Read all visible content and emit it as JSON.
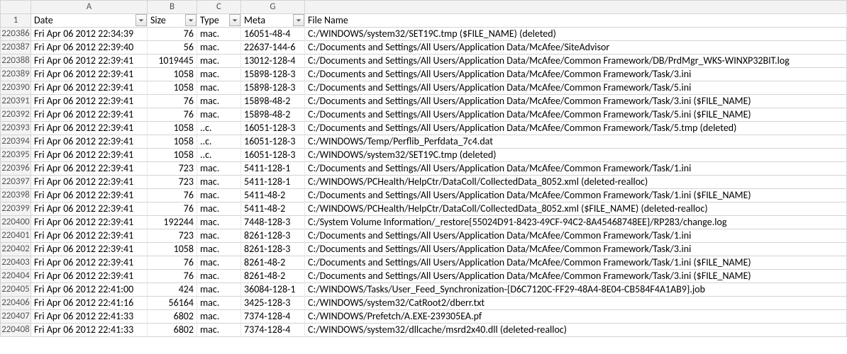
{
  "columns": {
    "letters": [
      "",
      "A",
      "B",
      "C",
      "G",
      ""
    ],
    "headers": [
      "Date",
      "Size",
      "Type",
      "Meta",
      "File Name"
    ],
    "filters": [
      true,
      true,
      true,
      true,
      false
    ],
    "header_row_number": "1"
  },
  "rows": [
    {
      "n": "220386",
      "date": "Fri Apr 06 2012 22:34:39",
      "size": "76",
      "type": "mac.",
      "meta": "16051-48-4",
      "file": "C:/WINDOWS/system32/SET19C.tmp ($FILE_NAME) (deleted)"
    },
    {
      "n": "220387",
      "date": "Fri Apr 06 2012 22:39:40",
      "size": "56",
      "type": "mac.",
      "meta": "22637-144-6",
      "file": "C:/Documents and Settings/All Users/Application Data/McAfee/SiteAdvisor"
    },
    {
      "n": "220388",
      "date": "Fri Apr 06 2012 22:39:41",
      "size": "1019445",
      "type": "mac.",
      "meta": "13012-128-4",
      "file": "C:/Documents and Settings/All Users/Application Data/McAfee/Common Framework/DB/PrdMgr_WKS-WINXP32BIT.log"
    },
    {
      "n": "220389",
      "date": "Fri Apr 06 2012 22:39:41",
      "size": "1058",
      "type": "mac.",
      "meta": "15898-128-3",
      "file": "C:/Documents and Settings/All Users/Application Data/McAfee/Common Framework/Task/3.ini"
    },
    {
      "n": "220390",
      "date": "Fri Apr 06 2012 22:39:41",
      "size": "1058",
      "type": "mac.",
      "meta": "15898-128-3",
      "file": "C:/Documents and Settings/All Users/Application Data/McAfee/Common Framework/Task/5.ini"
    },
    {
      "n": "220391",
      "date": "Fri Apr 06 2012 22:39:41",
      "size": "76",
      "type": "mac.",
      "meta": "15898-48-2",
      "file": "C:/Documents and Settings/All Users/Application Data/McAfee/Common Framework/Task/3.ini ($FILE_NAME)"
    },
    {
      "n": "220392",
      "date": "Fri Apr 06 2012 22:39:41",
      "size": "76",
      "type": "mac.",
      "meta": "15898-48-2",
      "file": "C:/Documents and Settings/All Users/Application Data/McAfee/Common Framework/Task/5.ini ($FILE_NAME)"
    },
    {
      "n": "220393",
      "date": "Fri Apr 06 2012 22:39:41",
      "size": "1058",
      "type": "..c.",
      "meta": "16051-128-3",
      "file": "C:/Documents and Settings/All Users/Application Data/McAfee/Common Framework/Task/5.tmp (deleted)"
    },
    {
      "n": "220394",
      "date": "Fri Apr 06 2012 22:39:41",
      "size": "1058",
      "type": "..c.",
      "meta": "16051-128-3",
      "file": "C:/WINDOWS/Temp/Perflib_Perfdata_7c4.dat"
    },
    {
      "n": "220395",
      "date": "Fri Apr 06 2012 22:39:41",
      "size": "1058",
      "type": "..c.",
      "meta": "16051-128-3",
      "file": "C:/WINDOWS/system32/SET19C.tmp (deleted)"
    },
    {
      "n": "220396",
      "date": "Fri Apr 06 2012 22:39:41",
      "size": "723",
      "type": "mac.",
      "meta": "5411-128-1",
      "file": "C:/Documents and Settings/All Users/Application Data/McAfee/Common Framework/Task/1.ini"
    },
    {
      "n": "220397",
      "date": "Fri Apr 06 2012 22:39:41",
      "size": "723",
      "type": "mac.",
      "meta": "5411-128-1",
      "file": "C:/WINDOWS/PCHealth/HelpCtr/DataColl/CollectedData_8052.xml (deleted-realloc)"
    },
    {
      "n": "220398",
      "date": "Fri Apr 06 2012 22:39:41",
      "size": "76",
      "type": "mac.",
      "meta": "5411-48-2",
      "file": "C:/Documents and Settings/All Users/Application Data/McAfee/Common Framework/Task/1.ini ($FILE_NAME)"
    },
    {
      "n": "220399",
      "date": "Fri Apr 06 2012 22:39:41",
      "size": "76",
      "type": "mac.",
      "meta": "5411-48-2",
      "file": "C:/WINDOWS/PCHealth/HelpCtr/DataColl/CollectedData_8052.xml ($FILE_NAME) (deleted-realloc)"
    },
    {
      "n": "220400",
      "date": "Fri Apr 06 2012 22:39:41",
      "size": "192244",
      "type": "mac.",
      "meta": "7448-128-3",
      "file": "C:/System Volume Information/_restore{55024D91-8423-49CF-94C2-8A45468748EE}/RP283/change.log"
    },
    {
      "n": "220401",
      "date": "Fri Apr 06 2012 22:39:41",
      "size": "723",
      "type": "mac.",
      "meta": "8261-128-3",
      "file": "C:/Documents and Settings/All Users/Application Data/McAfee/Common Framework/Task/1.ini"
    },
    {
      "n": "220402",
      "date": "Fri Apr 06 2012 22:39:41",
      "size": "1058",
      "type": "mac.",
      "meta": "8261-128-3",
      "file": "C:/Documents and Settings/All Users/Application Data/McAfee/Common Framework/Task/3.ini"
    },
    {
      "n": "220403",
      "date": "Fri Apr 06 2012 22:39:41",
      "size": "76",
      "type": "mac.",
      "meta": "8261-48-2",
      "file": "C:/Documents and Settings/All Users/Application Data/McAfee/Common Framework/Task/1.ini ($FILE_NAME)"
    },
    {
      "n": "220404",
      "date": "Fri Apr 06 2012 22:39:41",
      "size": "76",
      "type": "mac.",
      "meta": "8261-48-2",
      "file": "C:/Documents and Settings/All Users/Application Data/McAfee/Common Framework/Task/3.ini ($FILE_NAME)"
    },
    {
      "n": "220405",
      "date": "Fri Apr 06 2012 22:41:00",
      "size": "424",
      "type": "mac.",
      "meta": "36084-128-1",
      "file": "C:/WINDOWS/Tasks/User_Feed_Synchronization-{D6C7120C-FF29-48A4-8E04-CB584F4A1AB9}.job"
    },
    {
      "n": "220406",
      "date": "Fri Apr 06 2012 22:41:16",
      "size": "56164",
      "type": "mac.",
      "meta": "3425-128-3",
      "file": "C:/WINDOWS/system32/CatRoot2/dberr.txt"
    },
    {
      "n": "220407",
      "date": "Fri Apr 06 2012 22:41:33",
      "size": "6802",
      "type": "mac.",
      "meta": "7374-128-4",
      "file": "C:/WINDOWS/Prefetch/A.EXE-239305EA.pf"
    },
    {
      "n": "220408",
      "date": "Fri Apr 06 2012 22:41:33",
      "size": "6802",
      "type": "mac.",
      "meta": "7374-128-4",
      "file": "C:/WINDOWS/system32/dllcache/msrd2x40.dll (deleted-realloc)"
    }
  ]
}
